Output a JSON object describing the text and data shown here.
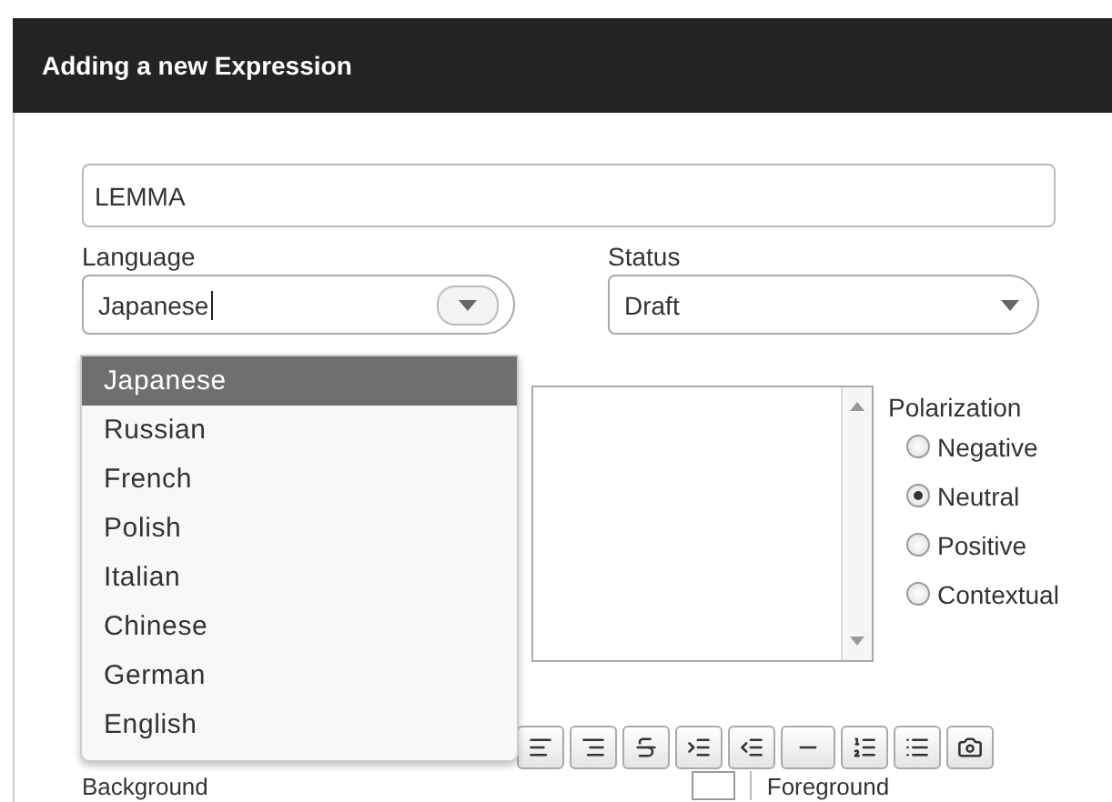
{
  "window": {
    "title": "Adding a new Expression"
  },
  "lemma": {
    "value": "LEMMA"
  },
  "language": {
    "label": "Language",
    "value": "Japanese"
  },
  "status": {
    "label": "Status",
    "value": "Draft"
  },
  "language_dropdown": [
    {
      "label": "Japanese",
      "selected": true
    },
    {
      "label": "Russian",
      "selected": false
    },
    {
      "label": "French",
      "selected": false
    },
    {
      "label": "Polish",
      "selected": false
    },
    {
      "label": "Italian",
      "selected": false
    },
    {
      "label": "Chinese",
      "selected": false
    },
    {
      "label": "German",
      "selected": false
    },
    {
      "label": "English",
      "selected": false
    }
  ],
  "polarization": {
    "label": "Polarization",
    "options": [
      {
        "label": "Negative",
        "selected": false
      },
      {
        "label": "Neutral",
        "selected": true
      },
      {
        "label": "Positive",
        "selected": false
      },
      {
        "label": "Contextual",
        "selected": false
      }
    ]
  },
  "colors": {
    "background_label": "Background",
    "foreground_label": "Foreground"
  }
}
